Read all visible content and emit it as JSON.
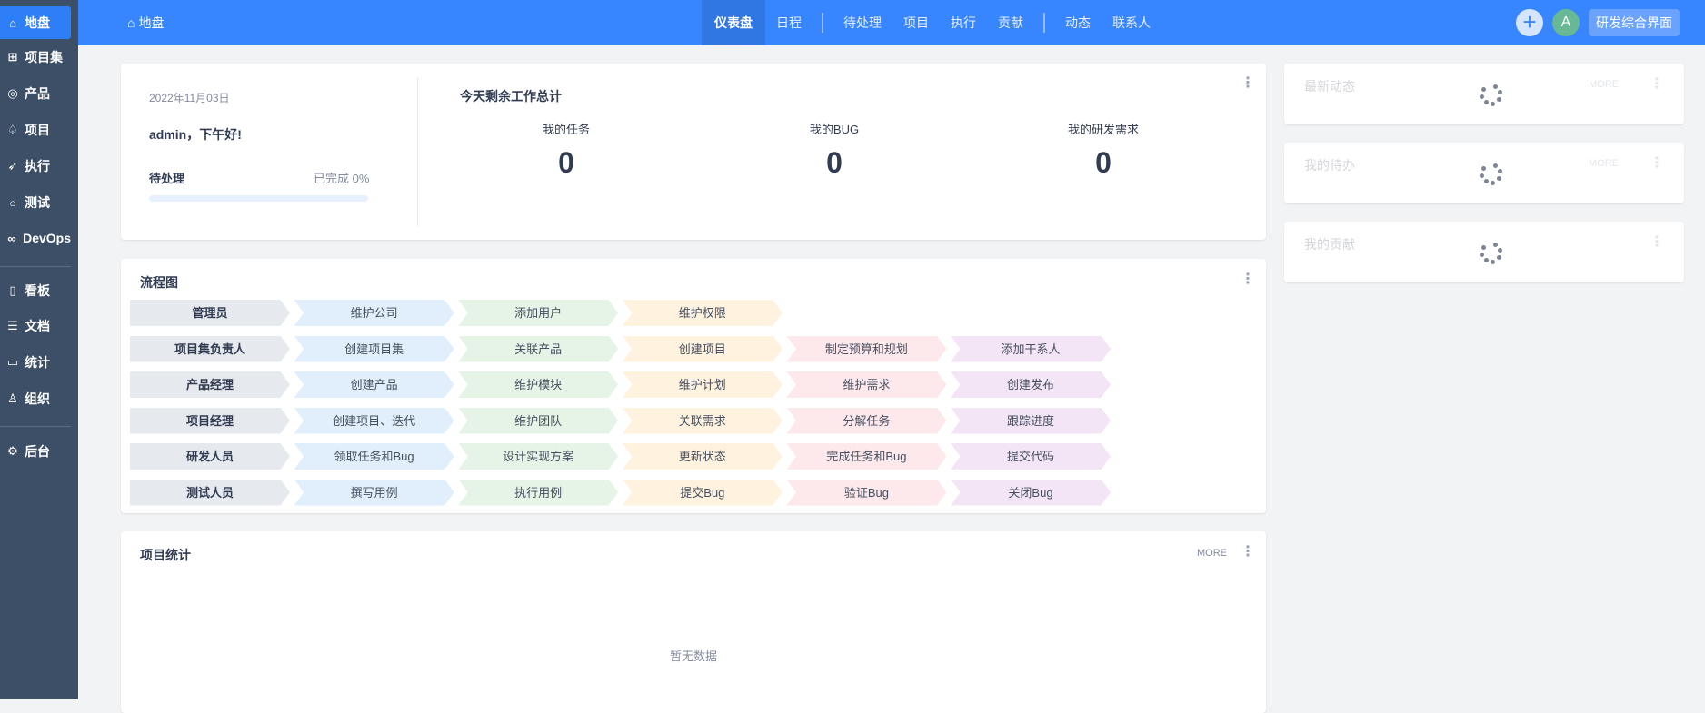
{
  "sidebar": {
    "items": [
      {
        "label": "地盘",
        "icon": "home-icon",
        "glyph": "⌂",
        "active": true
      },
      {
        "label": "项目集",
        "icon": "grid-icon",
        "glyph": "⊞"
      },
      {
        "label": "产品",
        "icon": "lightbulb-icon",
        "glyph": "◎"
      },
      {
        "label": "项目",
        "icon": "rocket-icon",
        "glyph": "♤"
      },
      {
        "label": "执行",
        "icon": "runner-icon",
        "glyph": "➶"
      },
      {
        "label": "测试",
        "icon": "magnifier-icon",
        "glyph": "○"
      },
      {
        "label": "DevOps",
        "icon": "infinity-icon",
        "glyph": "∞"
      },
      {
        "label": "看板",
        "icon": "kanban-icon",
        "glyph": "▯"
      },
      {
        "label": "文档",
        "icon": "document-icon",
        "glyph": "☰"
      },
      {
        "label": "统计",
        "icon": "monitor-icon",
        "glyph": "▭"
      },
      {
        "label": "组织",
        "icon": "user-icon",
        "glyph": "♙"
      },
      {
        "label": "后台",
        "icon": "gear-icon",
        "glyph": "⚙"
      }
    ]
  },
  "header": {
    "breadcrumb": "地盘",
    "nav": [
      "仪表盘",
      "日程",
      "待处理",
      "项目",
      "执行",
      "贡献",
      "动态",
      "联系人"
    ],
    "active_nav": "仪表盘",
    "avatar": "A",
    "switch_label": "研发综合界面",
    "colors": {
      "primary": "#3785ff"
    }
  },
  "welcome": {
    "date": "2022年11月03日",
    "greeting": "admin，下午好!",
    "pending_label": "待处理",
    "completed": "已完成 0%",
    "progress_percent": 0,
    "summary_title": "今天剩余工作总计",
    "stats": [
      {
        "label": "我的任务",
        "value": "0"
      },
      {
        "label": "我的BUG",
        "value": "0"
      },
      {
        "label": "我的研发需求",
        "value": "0"
      }
    ]
  },
  "flow": {
    "title": "流程图",
    "rows": [
      [
        "管理员",
        "维护公司",
        "添加用户",
        "维护权限"
      ],
      [
        "项目集负责人",
        "创建项目集",
        "关联产品",
        "创建项目",
        "制定预算和规划",
        "添加干系人"
      ],
      [
        "产品经理",
        "创建产品",
        "维护模块",
        "维护计划",
        "维护需求",
        "创建发布"
      ],
      [
        "项目经理",
        "创建项目、迭代",
        "维护团队",
        "关联需求",
        "分解任务",
        "跟踪进度"
      ],
      [
        "研发人员",
        "领取任务和Bug",
        "设计实现方案",
        "更新状态",
        "完成任务和Bug",
        "提交代码"
      ],
      [
        "测试人员",
        "撰写用例",
        "执行用例",
        "提交Bug",
        "验证Bug",
        "关闭Bug"
      ]
    ]
  },
  "project_stats": {
    "title": "项目统计",
    "more": "MORE",
    "empty": "暂无数据"
  },
  "right": [
    {
      "title": "最新动态",
      "more": "MORE"
    },
    {
      "title": "我的待办",
      "more": "MORE"
    },
    {
      "title": "我的贡献"
    }
  ]
}
